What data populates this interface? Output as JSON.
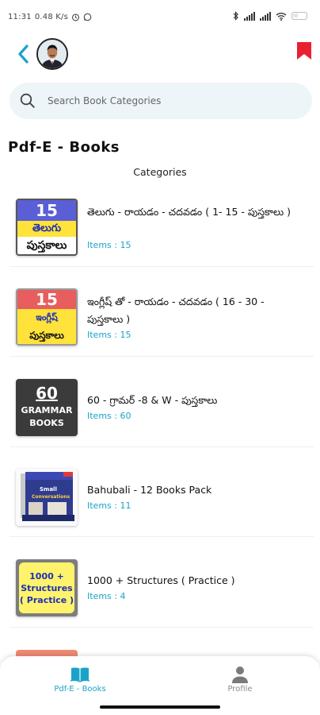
{
  "status_bar": {
    "time": "11:31",
    "speed": "0.48 K/s",
    "network_labels": [
      "4G",
      "4G"
    ]
  },
  "header": {
    "back_icon": "chevron-left-icon",
    "bookmark_icon": "bookmark-icon",
    "accent_color": "#1aa3c9",
    "bookmark_color": "#e8202f"
  },
  "search": {
    "placeholder": "Search Book Categories",
    "value": ""
  },
  "page_title": "Pdf-E - Books",
  "section_title": "Categories",
  "categories": [
    {
      "title": "తెలుగు - రాయడం - చదవడం     ( 1- 15 - పుస్తకాలు )",
      "count": "Items : 15",
      "thumb": {
        "line1": "15",
        "line2": "తెలుగు",
        "line3": "పుస్తకాలు"
      }
    },
    {
      "title": "ఇంగ్లీష్ తో - రాయడం - చదవడం ( 16 - 30 - పుస్తకాలు )",
      "count": "Items : 15",
      "thumb": {
        "line1": "15",
        "line2": "ఇంగ్లీష్",
        "line3": "పుస్తకాలు"
      }
    },
    {
      "title": "60 - గ్రామర్ -8 & W - పుస్తకాలు",
      "count": "Items : 60",
      "thumb": {
        "line1": "60",
        "line2": "GRAMMAR",
        "line3": "BOOKS"
      }
    },
    {
      "title": "Bahubali - 12 Books Pack",
      "count": "Items : 11",
      "thumb": {
        "line1": "Small",
        "line2": "Conversations"
      }
    },
    {
      "title": "1000 + Structures ( Practice )",
      "count": "Items : 4",
      "thumb": {
        "line1": "1000 +",
        "line2": "Structures",
        "line3": "( Practice )"
      }
    }
  ],
  "bottom_nav": {
    "books_label": "Pdf-E - Books",
    "profile_label": "Profile",
    "active": "Pdf-E - Books"
  }
}
